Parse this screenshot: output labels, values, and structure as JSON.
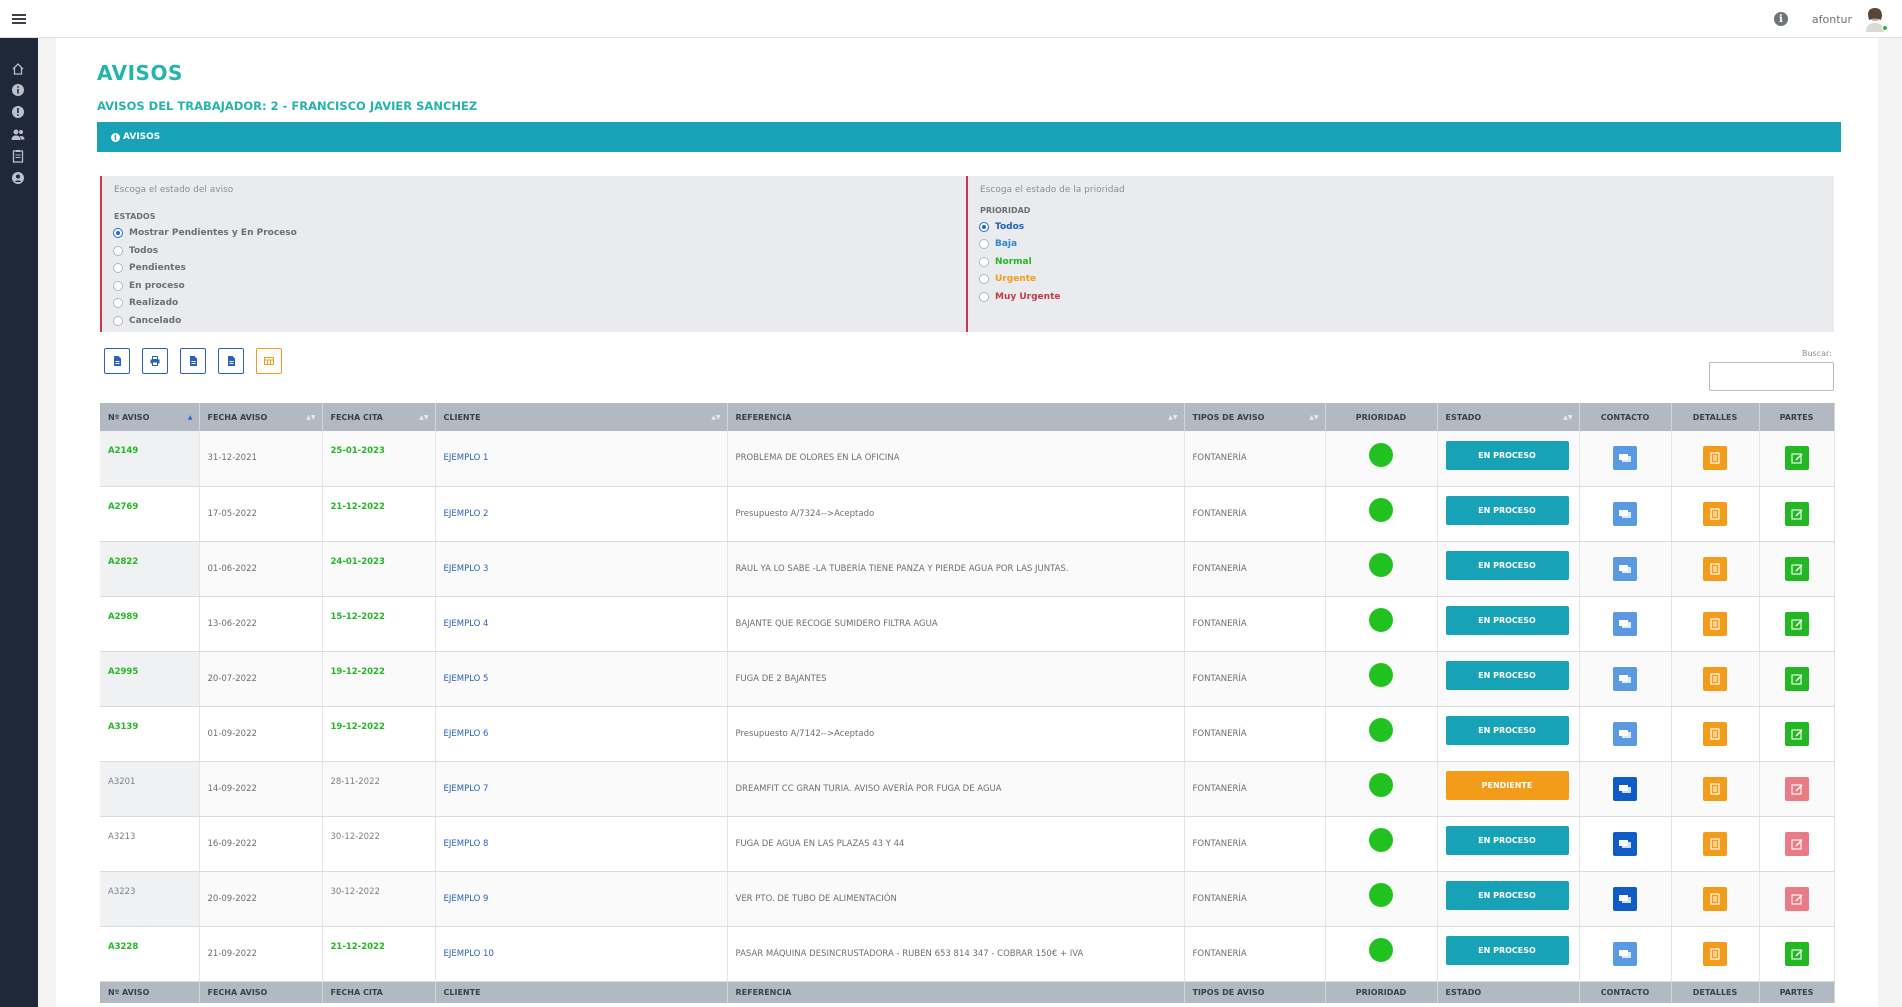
{
  "user": {
    "name": "afontur"
  },
  "page": {
    "title": "AVISOS",
    "subtitle": "AVISOS DEL TRABAJADOR: 2 - FRANCISCO JAVIER SANCHEZ",
    "section": "AVISOS"
  },
  "colors": {
    "accent": "#26b3ad",
    "bar": "#17a2b8",
    "pending": "#f39c1a",
    "sidebar": "#1e2838"
  },
  "estados": {
    "title": "Escoga el estado del aviso",
    "label": "ESTADOS",
    "options": [
      "Mostrar Pendientes y En Proceso",
      "Todos",
      "Pendientes",
      "En proceso",
      "Realizado",
      "Cancelado"
    ],
    "selected": 0
  },
  "prioridad": {
    "title": "Escoga el estado de la prioridad",
    "label": "PRIORIDAD",
    "options": [
      {
        "label": "Todos",
        "color": "#1b5fbf"
      },
      {
        "label": "Baja",
        "color": "#2f86c9"
      },
      {
        "label": "Normal",
        "color": "#21b821"
      },
      {
        "label": "Urgente",
        "color": "#f39c1a"
      },
      {
        "label": "Muy Urgente",
        "color": "#c53a45"
      }
    ],
    "selected": 0
  },
  "toolbar": {
    "buttons": [
      "file-icon",
      "print-icon",
      "file-icon",
      "file-icon",
      "table-icon"
    ],
    "search_label": "Buscar:",
    "search_value": ""
  },
  "table": {
    "headers": [
      "Nº AVISO",
      "FECHA AVISO",
      "FECHA CITA",
      "CLIENTE",
      "REFERENCIA",
      "TIPOS DE AVISO",
      "PRIORIDAD",
      "ESTADO",
      "CONTACTO",
      "DETALLES",
      "PARTES"
    ],
    "rows": [
      {
        "num": "A2149",
        "highlight": true,
        "fecha": "31-12-2021",
        "cita": "25-01-2023",
        "cliente": "EJEMPLO 1",
        "ref": "PROBLEMA DE OLORES EN LA OFICINA",
        "tipo": "FONTANERÍA",
        "estado": "EN PROCESO",
        "contact_dark": false,
        "parte_done": true
      },
      {
        "num": "A2769",
        "highlight": true,
        "fecha": "17-05-2022",
        "cita": "21-12-2022",
        "cliente": "EJEMPLO 2",
        "ref": "Presupuesto A/7324-->Aceptado",
        "tipo": "FONTANERÍA",
        "estado": "EN PROCESO",
        "contact_dark": false,
        "parte_done": true
      },
      {
        "num": "A2822",
        "highlight": true,
        "fecha": "01-06-2022",
        "cita": "24-01-2023",
        "cliente": "EJEMPLO 3",
        "ref": "RAUL YA LO SABE -LA TUBERÍA TIENE PANZA Y PIERDE AGUA POR LAS JUNTAS.",
        "tipo": "FONTANERÍA",
        "estado": "EN PROCESO",
        "contact_dark": false,
        "parte_done": true
      },
      {
        "num": "A2989",
        "highlight": true,
        "fecha": "13-06-2022",
        "cita": "15-12-2022",
        "cliente": "EJEMPLO 4",
        "ref": "BAJANTE QUE RECOGE SUMIDERO FILTRA AGUA",
        "tipo": "FONTANERÍA",
        "estado": "EN PROCESO",
        "contact_dark": false,
        "parte_done": true
      },
      {
        "num": "A2995",
        "highlight": true,
        "fecha": "20-07-2022",
        "cita": "19-12-2022",
        "cliente": "EJEMPLO 5",
        "ref": "FUGA DE 2 BAJANTES",
        "tipo": "FONTANERÍA",
        "estado": "EN PROCESO",
        "contact_dark": false,
        "parte_done": true
      },
      {
        "num": "A3139",
        "highlight": true,
        "fecha": "01-09-2022",
        "cita": "19-12-2022",
        "cliente": "EJEMPLO 6",
        "ref": "Presupuesto A/7142-->Aceptado",
        "tipo": "FONTANERÍA",
        "estado": "EN PROCESO",
        "contact_dark": false,
        "parte_done": true
      },
      {
        "num": "A3201",
        "highlight": false,
        "fecha": "14-09-2022",
        "cita": "28-11-2022",
        "cliente": "EJEMPLO 7",
        "ref": "DREAMFIT CC GRAN TURIA. AVISO AVERÍA POR FUGA DE AGUA",
        "tipo": "FONTANERÍA",
        "estado": "PENDIENTE",
        "contact_dark": true,
        "parte_done": false
      },
      {
        "num": "A3213",
        "highlight": false,
        "fecha": "16-09-2022",
        "cita": "30-12-2022",
        "cliente": "EJEMPLO 8",
        "ref": "FUGA DE AGUA EN LAS PLAZAS 43 Y 44",
        "tipo": "FONTANERÍA",
        "estado": "EN PROCESO",
        "contact_dark": true,
        "parte_done": false
      },
      {
        "num": "A3223",
        "highlight": false,
        "fecha": "20-09-2022",
        "cita": "30-12-2022",
        "cliente": "EJEMPLO 9",
        "ref": "VER PTO. DE TUBO DE ALIMENTACIÓN",
        "tipo": "FONTANERÍA",
        "estado": "EN PROCESO",
        "contact_dark": true,
        "parte_done": false
      },
      {
        "num": "A3228",
        "highlight": true,
        "fecha": "21-09-2022",
        "cita": "21-12-2022",
        "cliente": "EJEMPLO 10",
        "ref": "PASAR MÁQUINA DESINCRUSTADORA - RUBEN 653 814 347 - COBRAR 150€ + IVA",
        "tipo": "FONTANERÍA",
        "estado": "EN PROCESO",
        "contact_dark": false,
        "parte_done": true
      }
    ]
  }
}
